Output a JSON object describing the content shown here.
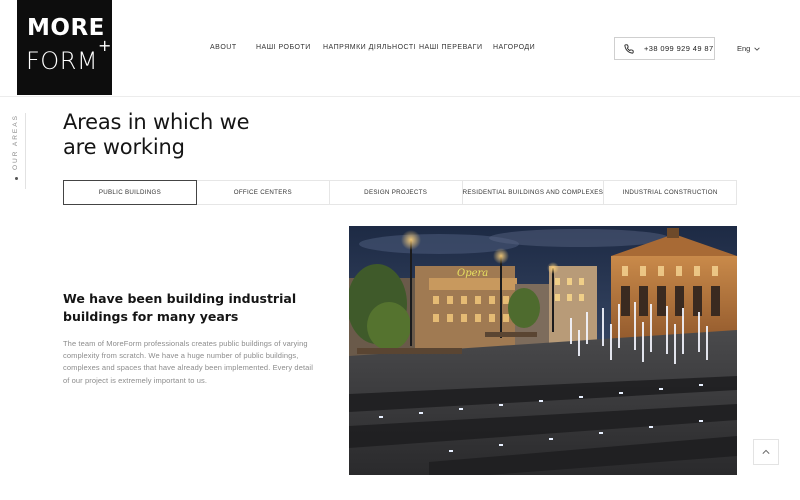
{
  "logo": {
    "line1": "MORE",
    "line2": "FORM",
    "plus": "+"
  },
  "nav": {
    "items": [
      {
        "label": "About",
        "name": "nav-about"
      },
      {
        "label": "Наші роботи",
        "name": "nav-our-works"
      },
      {
        "label": "Напрямки діяльності",
        "name": "nav-activities"
      },
      {
        "label": "Наші переваги",
        "name": "nav-advantages"
      },
      {
        "label": "Нагороди",
        "name": "nav-awards"
      }
    ]
  },
  "phone": {
    "number": "+38 099 929 49 87",
    "icon": "phone-icon"
  },
  "language": {
    "current": "Eng",
    "icon": "chevron-down-icon"
  },
  "side_label": "OUR AREAS",
  "section": {
    "title_line1": "Areas in which we",
    "title_line2": "are working"
  },
  "tabs": [
    {
      "label": "Public buildings",
      "active": true
    },
    {
      "label": "Office centers",
      "active": false
    },
    {
      "label": "Design projects",
      "active": false
    },
    {
      "label": "Residential buildings and complexes",
      "active": false
    },
    {
      "label": "Industrial construction",
      "active": false
    }
  ],
  "content": {
    "heading": "We have been building industrial buildings for many years",
    "paragraph": "The team of MoreForm professionals creates public buildings of varying complexity from scratch. We have a huge number of public buildings, complexes and spaces that have already been implemented. Every detail of our project is extremely important to us."
  },
  "photo": {
    "sign_text": "Opera"
  },
  "colors": {
    "accent": "#0d0d0d",
    "muted_text": "#8c8c8c",
    "border": "#e6e6e6"
  }
}
